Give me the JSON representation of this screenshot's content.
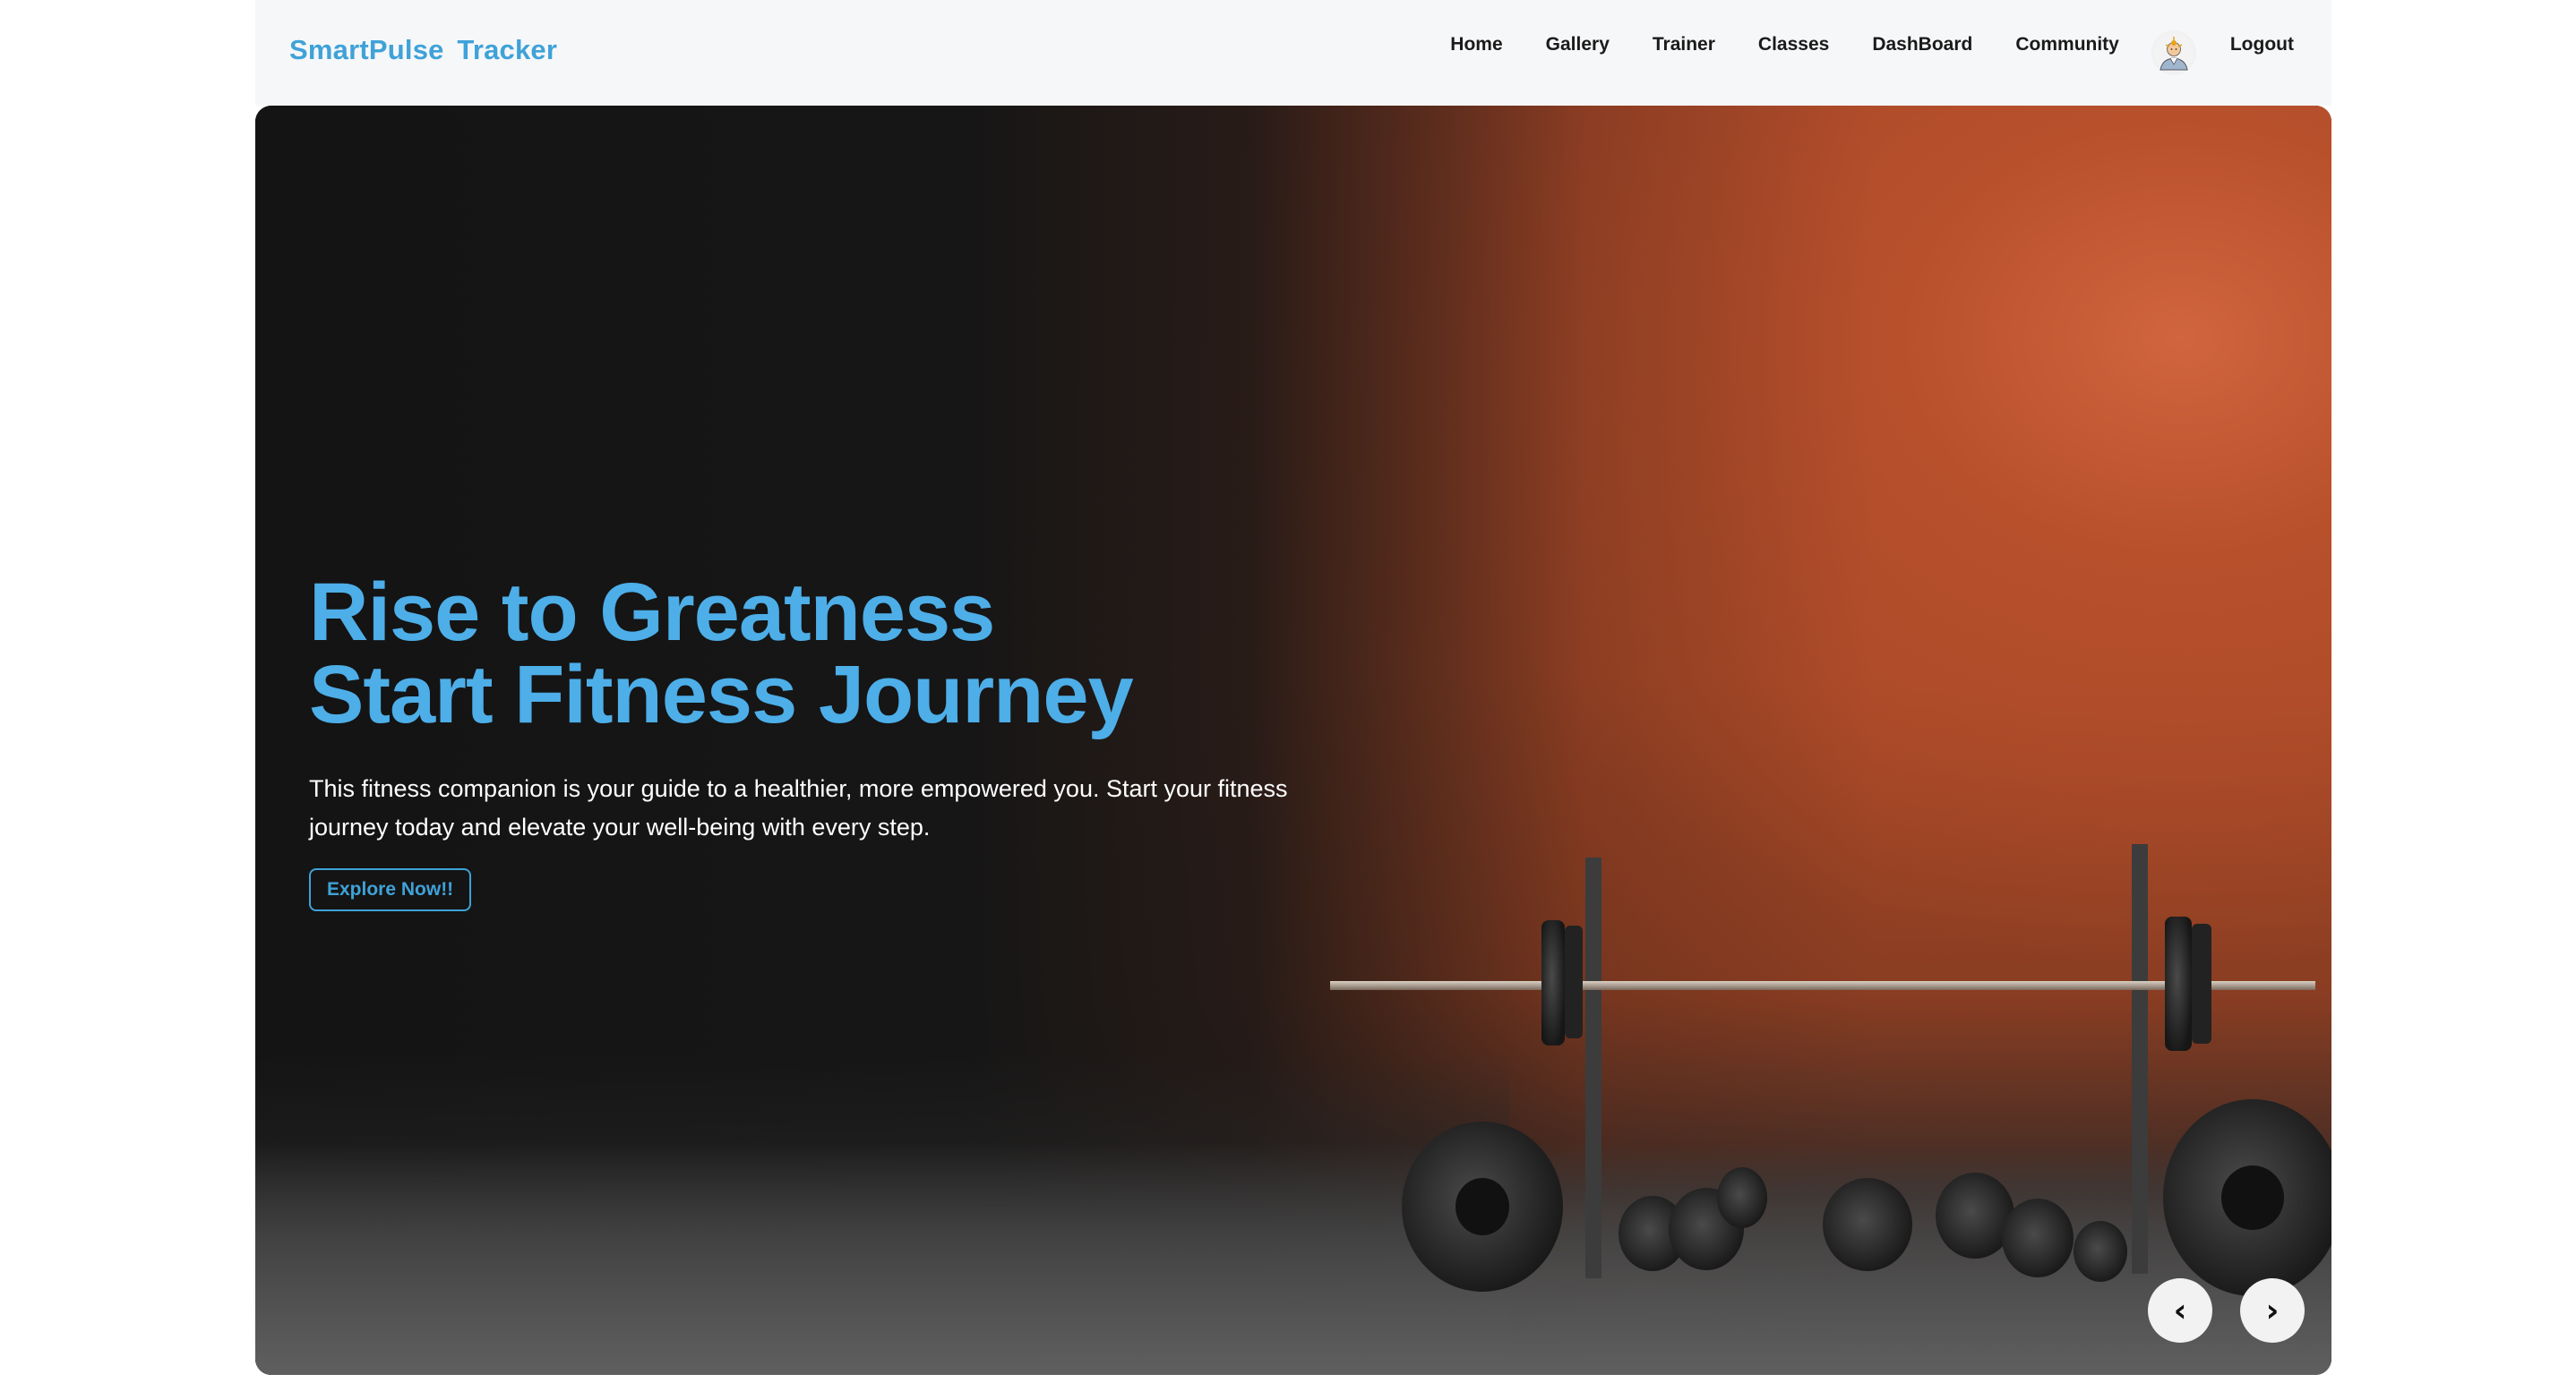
{
  "navbar": {
    "brand": "SmartPulse Tracker",
    "links": [
      "Home",
      "Gallery",
      "Trainer",
      "Classes",
      "DashBoard",
      "Community"
    ],
    "logout": "Logout",
    "avatar_icon": "user-avatar-icon"
  },
  "hero": {
    "title_line1": "Rise to Greatness",
    "title_line2": "Start Fitness Journey",
    "description": "This fitness companion is your guide to a healthier, more empowered you. Start your fitness journey today and elevate your well-being with every step.",
    "cta_label": "Explore Now!!",
    "prev_label": "‹",
    "next_label": "›"
  },
  "colors": {
    "brand": "#3fa2d8",
    "title": "#4daee8",
    "navbar_bg": "#f6f7f9"
  }
}
